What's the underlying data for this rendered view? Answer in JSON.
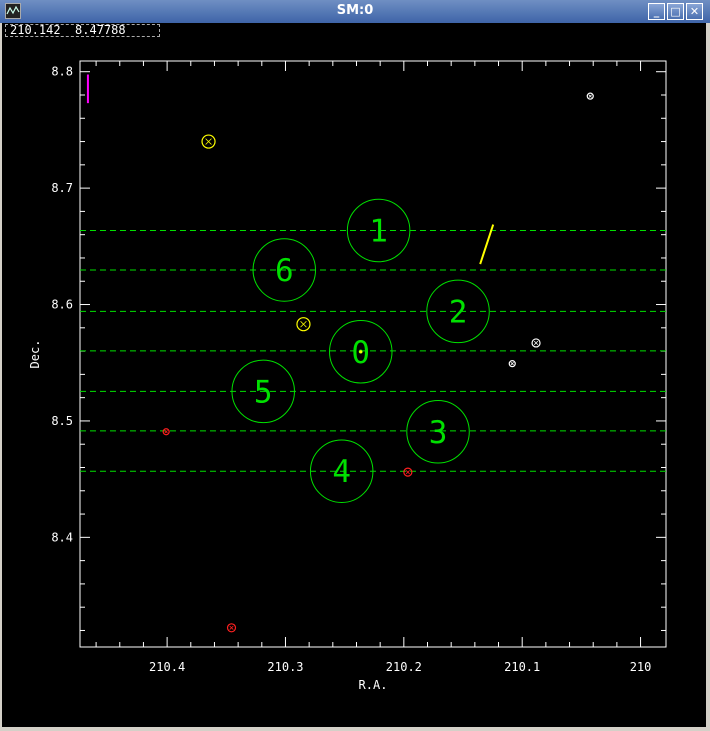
{
  "window": {
    "title": "SM:0",
    "minimize_label": "_",
    "maximize_label": "□",
    "close_label": "✕"
  },
  "readout": {
    "text": "210.142  8.47788"
  },
  "colors": {
    "frame": "#ffffff",
    "circle": "#00e000",
    "dashed": "#00e000",
    "label": "#00e000",
    "yellow": "#ffff00",
    "red": "#ff2020",
    "magenta": "#ff00ff",
    "white": "#ffffff"
  },
  "chart_data": {
    "type": "scatter",
    "xlabel": "R.A.",
    "ylabel": "Dec.",
    "xlim": [
      210.4736,
      209.9785
    ],
    "ylim": [
      8.3058,
      8.8092
    ],
    "x_ticks": [
      {
        "value": 210.4,
        "label": "210.4"
      },
      {
        "value": 210.3,
        "label": "210.3"
      },
      {
        "value": 210.2,
        "label": "210.2"
      },
      {
        "value": 210.1,
        "label": "210.1"
      },
      {
        "value": 210.0,
        "label": "210"
      }
    ],
    "y_ticks": [
      {
        "value": 8.4,
        "label": "8.4"
      },
      {
        "value": 8.5,
        "label": "8.5"
      },
      {
        "value": 8.6,
        "label": "8.6"
      },
      {
        "value": 8.7,
        "label": "8.7"
      },
      {
        "value": 8.8,
        "label": "8.8"
      }
    ],
    "dashed_lines_dec": [
      8.6636,
      8.6297,
      8.5941,
      8.5602,
      8.5254,
      8.4915,
      8.4568
    ],
    "fields": [
      {
        "label": "0",
        "ra": 210.2364,
        "dec": 8.5594,
        "radius": 0.0264
      },
      {
        "label": "1",
        "ra": 210.2213,
        "dec": 8.6636,
        "radius": 0.0264
      },
      {
        "label": "2",
        "ra": 210.1542,
        "dec": 8.5941,
        "radius": 0.0264
      },
      {
        "label": "3",
        "ra": 210.1711,
        "dec": 8.4907,
        "radius": 0.0264
      },
      {
        "label": "4",
        "ra": 210.2525,
        "dec": 8.4568,
        "radius": 0.0264
      },
      {
        "label": "5",
        "ra": 210.3188,
        "dec": 8.5254,
        "radius": 0.0264
      },
      {
        "label": "6",
        "ra": 210.301,
        "dec": 8.6297,
        "radius": 0.0264
      }
    ],
    "markers": [
      {
        "ra": 210.365,
        "dec": 8.74,
        "color": "yellow",
        "size": "large"
      },
      {
        "ra": 210.2848,
        "dec": 8.5831,
        "color": "yellow",
        "size": "large"
      },
      {
        "ra": 210.2364,
        "dec": 8.5594,
        "color": "yellow",
        "size": "dot"
      },
      {
        "ra": 210.4008,
        "dec": 8.4907,
        "color": "red",
        "size": "small"
      },
      {
        "ra": 210.1966,
        "dec": 8.456,
        "color": "red",
        "size": "medium"
      },
      {
        "ra": 210.3456,
        "dec": 8.3223,
        "color": "red",
        "size": "medium"
      },
      {
        "ra": 210.0883,
        "dec": 8.567,
        "color": "white",
        "size": "medium"
      },
      {
        "ra": 210.1084,
        "dec": 8.5492,
        "color": "white",
        "size": "small"
      },
      {
        "ra": 210.0425,
        "dec": 8.779,
        "color": "white",
        "size": "small"
      }
    ],
    "streaks": [
      {
        "ra1": 210.1355,
        "dec1": 8.6348,
        "ra2": 210.1245,
        "dec2": 8.6687,
        "color": "yellow"
      },
      {
        "ra1": 210.4669,
        "dec1": 8.773,
        "ra2": 210.4669,
        "dec2": 8.7976,
        "color": "magenta"
      }
    ]
  }
}
